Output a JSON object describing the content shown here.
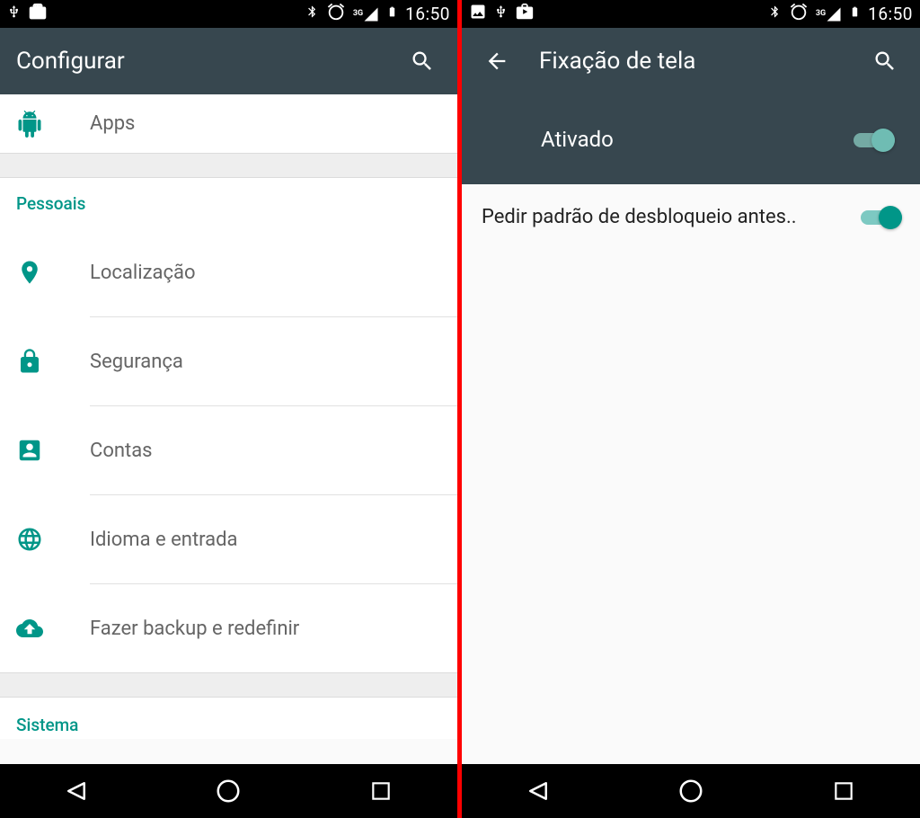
{
  "status": {
    "time": "16:50",
    "net": "3G"
  },
  "left": {
    "title": "Configurar",
    "items": {
      "apps": "Apps",
      "section_personal": "Pessoais",
      "location": "Localização",
      "security": "Segurança",
      "accounts": "Contas",
      "language": "Idioma e entrada",
      "backup": "Fazer backup e redefinir",
      "section_system": "Sistema"
    }
  },
  "right": {
    "title": "Fixação de tela",
    "master_label": "Ativado",
    "option_label": "Pedir padrão de desbloqueio antes.."
  }
}
